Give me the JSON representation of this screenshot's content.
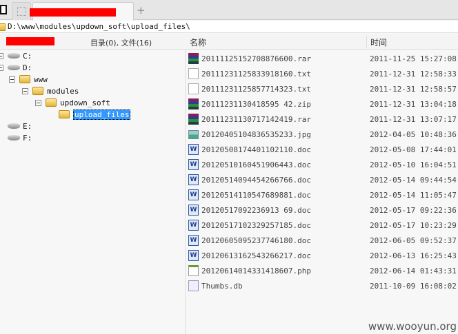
{
  "path": "D:\\www\\modules\\updown_soft\\upload_files\\",
  "header": {
    "count": "目录(0), 文件(16)",
    "col_name": "名称",
    "col_time": "时间"
  },
  "tree": [
    {
      "label": "C:",
      "type": "drive",
      "level": 0,
      "expanded": true
    },
    {
      "label": "D:",
      "type": "drive",
      "level": 0,
      "expanded": true
    },
    {
      "label": "www",
      "type": "folder",
      "level": 1,
      "expanded": true
    },
    {
      "label": "modules",
      "type": "folder",
      "level": 2,
      "expanded": true
    },
    {
      "label": "updown_soft",
      "type": "folder",
      "level": 3,
      "expanded": true
    },
    {
      "label": "upload_files",
      "type": "folder",
      "level": 4,
      "selected": true
    },
    {
      "label": "E:",
      "type": "drive",
      "level": 0
    },
    {
      "label": "F:",
      "type": "drive",
      "level": 0
    }
  ],
  "files": [
    {
      "name": "20111125152708876600.rar",
      "time": "2011-11-25 15:27:08",
      "icon": "rar"
    },
    {
      "name": "20111231125833918160.txt",
      "time": "2011-12-31 12:58:33",
      "icon": "txt"
    },
    {
      "name": "20111231125857714323.txt",
      "time": "2011-12-31 12:58:57",
      "icon": "txt"
    },
    {
      "name": "20111231130418595 42.zip",
      "time": "2011-12-31 13:04:18",
      "icon": "rar"
    },
    {
      "name": "20111231130717142419.rar",
      "time": "2011-12-31 13:07:17",
      "icon": "rar"
    },
    {
      "name": "20120405104836535233.jpg",
      "time": "2012-04-05 10:48:36",
      "icon": "jpg"
    },
    {
      "name": "20120508174401102110.doc",
      "time": "2012-05-08 17:44:01",
      "icon": "doc"
    },
    {
      "name": "20120510160451906443.doc",
      "time": "2012-05-10 16:04:51",
      "icon": "doc"
    },
    {
      "name": "20120514094454266766.doc",
      "time": "2012-05-14 09:44:54",
      "icon": "doc"
    },
    {
      "name": "20120514110547689881.doc",
      "time": "2012-05-14 11:05:47",
      "icon": "doc"
    },
    {
      "name": "20120517092236913 69.doc",
      "time": "2012-05-17 09:22:36",
      "icon": "doc"
    },
    {
      "name": "20120517102329257185.doc",
      "time": "2012-05-17 10:23:29",
      "icon": "doc"
    },
    {
      "name": "20120605095237746180.doc",
      "time": "2012-06-05 09:52:37",
      "icon": "doc"
    },
    {
      "name": "20120613162543266217.doc",
      "time": "2012-06-13 16:25:43",
      "icon": "doc"
    },
    {
      "name": "20120614014331418607.php",
      "time": "2012-06-14 01:43:31",
      "icon": "php"
    },
    {
      "name": "Thumbs.db",
      "time": "2011-10-09 16:08:02",
      "icon": "db"
    }
  ],
  "watermark": "www.wooyun.org",
  "colors": {
    "selection": "#3399ff",
    "redaction": "#ff0000"
  }
}
